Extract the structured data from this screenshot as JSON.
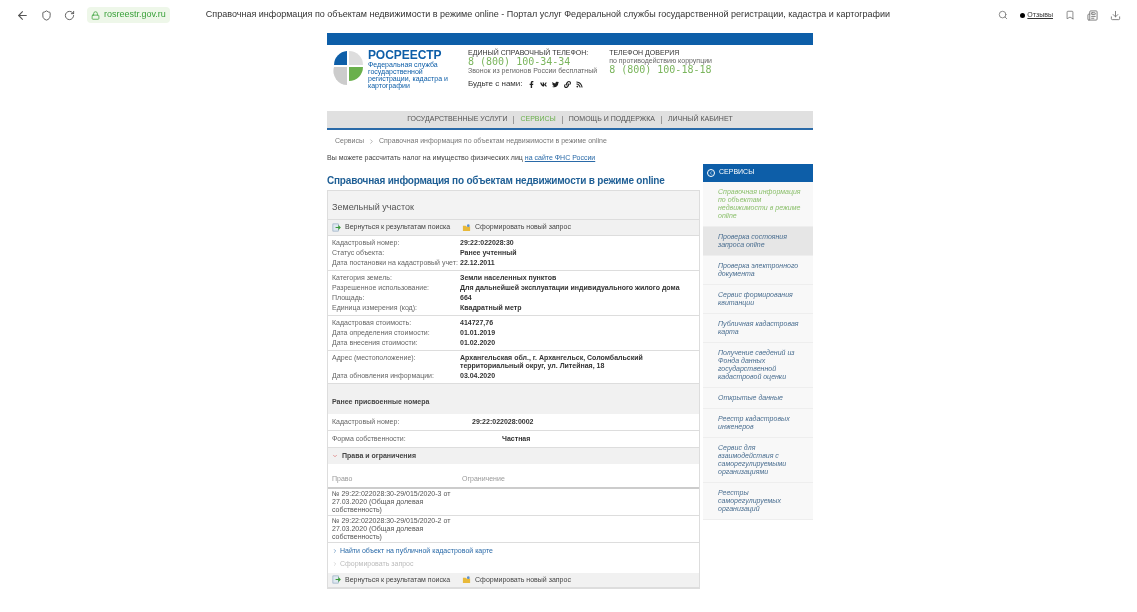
{
  "browser": {
    "domain": "rosreestr.gov.ru",
    "title": "Справочная информация по объектам недвижимости в режиме online - Портал услуг Федеральной службы государственной регистрации, кадастра и картографии",
    "feedback": "Отзывы"
  },
  "header": {
    "logo_title": "РОСРЕЕСТР",
    "logo_subtitle": "Федеральная служба государственной регистрации, кадастра и картографии",
    "phone_label": "ЕДИНЫЙ СПРАВОЧНЫЙ ТЕЛЕФОН:",
    "phone": "8 (800) 100-34-34",
    "phone_note": "Звонок из регионов России бесплатный",
    "trust_label": "ТЕЛЕФОН ДОВЕРИЯ",
    "trust_note": "по противодействию коррупции",
    "trust_phone": "8 (800) 100-18-18",
    "social_label": "Будьте с нами:",
    "social": [
      {
        "kind": "facebook"
      },
      {
        "kind": "vk"
      },
      {
        "kind": "twitter"
      },
      {
        "kind": "link"
      },
      {
        "kind": "rss"
      }
    ]
  },
  "nav": [
    {
      "label": "ГОСУДАРСТВЕННЫЕ УСЛУГИ",
      "selected": false
    },
    {
      "label": "СЕРВИСЫ",
      "selected": true
    },
    {
      "label": "ПОМОЩЬ И ПОДДЕРЖКА",
      "selected": false
    },
    {
      "label": "ЛИЧНЫЙ КАБИНЕТ",
      "selected": false
    }
  ],
  "breadcrumb": [
    "Сервисы",
    "Справочная информация по объектам недвижимости в режиме online"
  ],
  "tax_note": {
    "text": "Вы можете рассчитать налог на имущество физических лиц",
    "link": "на сайте ФНС России"
  },
  "page_title": "Справочная информация по объектам недвижимости в режиме online",
  "card": {
    "title": "Земельный участок",
    "toolbar": [
      "Вернуться к результатам поиска",
      "Сформировать новый запрос"
    ],
    "groups": [
      [
        {
          "label": "Кадастровый номер:",
          "value": "29:22:022028:30"
        },
        {
          "label": "Статус объекта:",
          "value": "Ранее учтенный"
        },
        {
          "label": "Дата постановки на кадастровый учет:",
          "value": "22.12.2011"
        }
      ],
      [
        {
          "label": "Категория земель:",
          "value": "Земли населенных пунктов"
        },
        {
          "label": "Разрешенное использование:",
          "value": "Для дальнейшей эксплуатации индивидуального жилого дома"
        },
        {
          "label": "Площадь:",
          "value": "664"
        },
        {
          "label": "Единица измерения (код):",
          "value": "Квадратный метр"
        }
      ],
      [
        {
          "label": "Кадастровая стоимость:",
          "value": "414727,76"
        },
        {
          "label": "Дата определения стоимости:",
          "value": "01.01.2019"
        },
        {
          "label": "Дата внесения стоимости:",
          "value": "01.02.2020"
        }
      ],
      [
        {
          "label": "Адрес (местоположение):",
          "value": "Архангельская обл., г. Архангельск, Соломбальский территориальный округ, ул. Литейная, 18"
        },
        {
          "label": "Дата обновления информации:",
          "value": "03.04.2020"
        }
      ]
    ],
    "prior_title": "Ранее присвоенные номера",
    "prior": {
      "label": "Кадастровый номер:",
      "value": "29:22:022028:0002"
    },
    "ownership": {
      "label": "Форма собственности:",
      "value": "Частная"
    },
    "rights": {
      "title": "Права и ограничения",
      "expanded": true,
      "columns": [
        "Право",
        "Ограничение"
      ],
      "rows": [
        "№ 29:22:022028:30-29/015/2020-3 от 27.03.2020 (Общая долевая собственность)",
        "№ 29:22:022028:30-29/015/2020-2 от 27.03.2020 (Общая долевая собственность)"
      ]
    },
    "links": [
      {
        "label": "Найти объект на публичной кадастровой карте",
        "disabled": false
      },
      {
        "label": "Сформировать запрос",
        "disabled": true
      }
    ],
    "bottom_toolbar": [
      "Вернуться к результатам поиска",
      "Сформировать новый запрос"
    ]
  },
  "sidebar": {
    "title": "СЕРВИСЫ",
    "items": [
      {
        "label": "Справочная информация по объектам недвижимости в режиме online",
        "selected": true,
        "highlighted": false
      },
      {
        "label": "Проверка состояния запроса online",
        "selected": false,
        "highlighted": true
      },
      {
        "label": "Проверка электронного документа",
        "selected": false,
        "highlighted": false
      },
      {
        "label": "Сервис формирования квитанции",
        "selected": false,
        "highlighted": false
      },
      {
        "label": "Публичная кадастровая карта",
        "selected": false,
        "highlighted": false
      },
      {
        "label": "Получение сведений из Фонда данных государственной кадастровой оценки",
        "selected": false,
        "highlighted": false
      },
      {
        "label": "Открытые данные",
        "selected": false,
        "highlighted": false
      },
      {
        "label": "Реестр кадастровых инженеров",
        "selected": false,
        "highlighted": false
      },
      {
        "label": "Сервис для взаимодействия с саморегулируемыми организациями",
        "selected": false,
        "highlighted": false
      },
      {
        "label": "Реестры саморегулируемых организаций",
        "selected": false,
        "highlighted": false
      }
    ]
  }
}
